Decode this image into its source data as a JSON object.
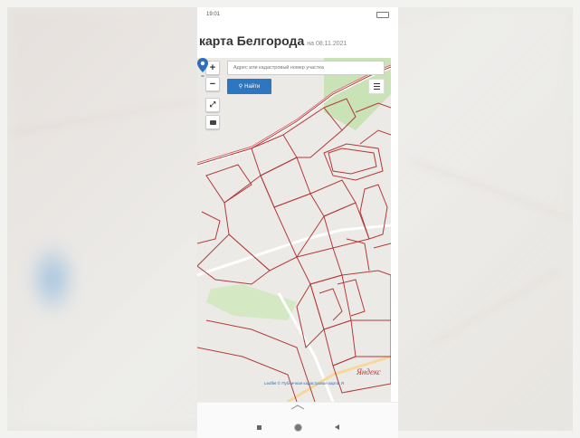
{
  "status_bar": {
    "time": "19:01",
    "right": ""
  },
  "header": {
    "title": "карта Белгорода",
    "date": "на 08.11.2021"
  },
  "map_controls": {
    "zoom_in": "+",
    "zoom_out": "−",
    "search_placeholder": "Адрес или кадастровый номер участка",
    "search_button": "Найти"
  },
  "map": {
    "logo": "Яндекс",
    "footer": "Leaflet © Публичная кадастровая карта, Я"
  },
  "colors": {
    "accent": "#2f76c0",
    "parcel_border": "#b33a3a",
    "green_area": "#c9e2b6",
    "pin": "#2c6fbb"
  }
}
